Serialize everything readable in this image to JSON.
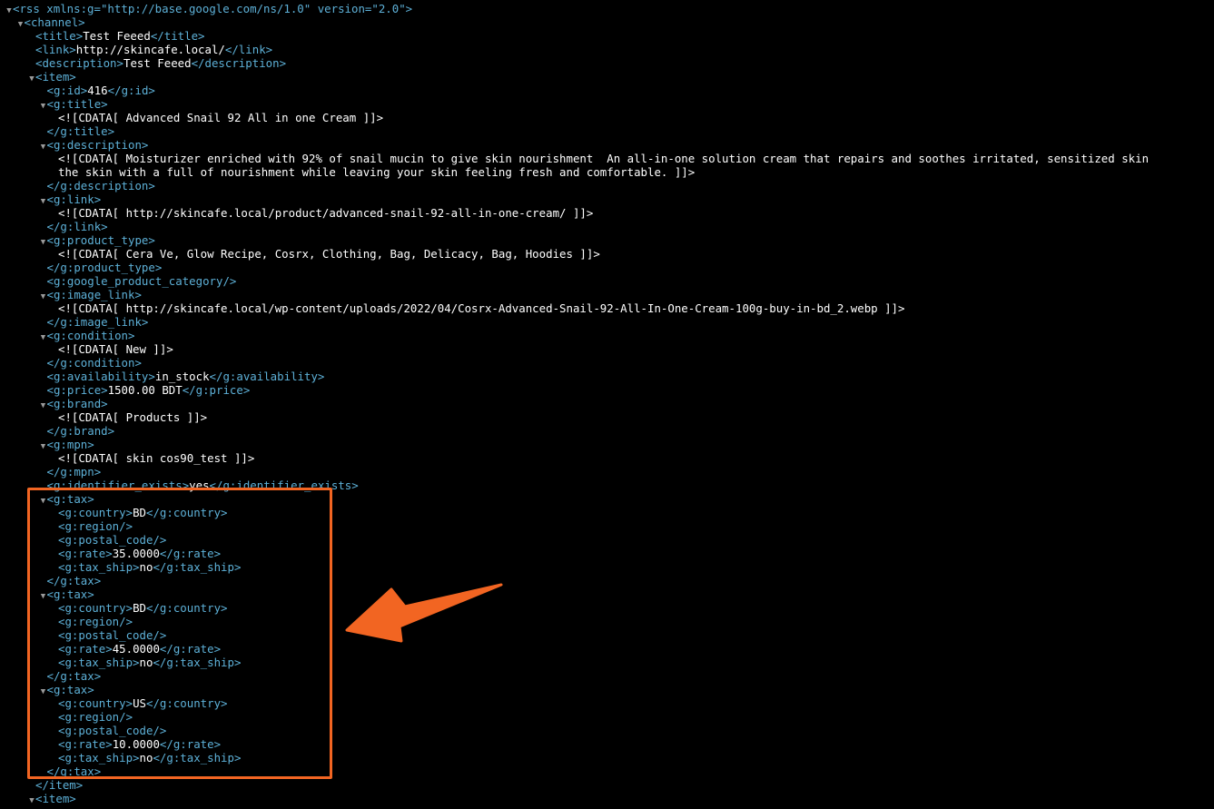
{
  "xml": {
    "rss_open": "<rss xmlns:g=\"http://base.google.com/ns/1.0\" version=\"2.0\">",
    "channel_open": "<channel>",
    "title_line": "<title>Test Feeed</title>",
    "link_line": "<link>http://skincafe.local/</link>",
    "description_line": "<description>Test Feeed</description>",
    "item_open": "<item>",
    "id_line": "<g:id>416</g:id>",
    "g_title_open": "<g:title>",
    "g_title_cdata": "<![CDATA[ Advanced Snail 92 All in one Cream ]]>",
    "g_title_close": "</g:title>",
    "g_description_open": "<g:description>",
    "g_description_cdata_1": "<![CDATA[ Moisturizer enriched with 92% of snail mucin to give skin nourishment  An all-in-one solution cream that repairs and soothes irritated, sensitized skin",
    "g_description_cdata_2": "the skin with a full of nourishment while leaving your skin feeling fresh and comfortable. ]]>",
    "g_description_close": "</g:description>",
    "g_link_open": "<g:link>",
    "g_link_cdata": "<![CDATA[ http://skincafe.local/product/advanced-snail-92-all-in-one-cream/ ]]>",
    "g_link_close": "</g:link>",
    "g_product_type_open": "<g:product_type>",
    "g_product_type_cdata": "<![CDATA[ Cera Ve, Glow Recipe, Cosrx, Clothing, Bag, Delicacy, Bag, Hoodies ]]>",
    "g_product_type_close": "</g:product_type>",
    "g_google_product_category": "<g:google_product_category/>",
    "g_image_link_open": "<g:image_link>",
    "g_image_link_cdata": "<![CDATA[ http://skincafe.local/wp-content/uploads/2022/04/Cosrx-Advanced-Snail-92-All-In-One-Cream-100g-buy-in-bd_2.webp ]]>",
    "g_image_link_close": "</g:image_link>",
    "g_condition_open": "<g:condition>",
    "g_condition_cdata": "<![CDATA[ New ]]>",
    "g_condition_close": "</g:condition>",
    "g_availability_line": "<g:availability>in_stock</g:availability>",
    "g_price_line": "<g:price>1500.00 BDT</g:price>",
    "g_brand_open": "<g:brand>",
    "g_brand_cdata": "<![CDATA[ Products ]]>",
    "g_brand_close": "</g:brand>",
    "g_mpn_open": "<g:mpn>",
    "g_mpn_cdata": "<![CDATA[ skin cos90_test ]]>",
    "g_mpn_close": "</g:mpn>",
    "g_identifier_exists_line": "<g:identifier_exists>yes</g:identifier_exists>",
    "tax_blocks": [
      {
        "open": "<g:tax>",
        "country": "<g:country>BD</g:country>",
        "region": "<g:region/>",
        "postal_code": "<g:postal_code/>",
        "rate": "<g:rate>35.0000</g:rate>",
        "tax_ship": "<g:tax_ship>no</g:tax_ship>",
        "close": "</g:tax>"
      },
      {
        "open": "<g:tax>",
        "country": "<g:country>BD</g:country>",
        "region": "<g:region/>",
        "postal_code": "<g:postal_code/>",
        "rate": "<g:rate>45.0000</g:rate>",
        "tax_ship": "<g:tax_ship>no</g:tax_ship>",
        "close": "</g:tax>"
      },
      {
        "open": "<g:tax>",
        "country": "<g:country>US</g:country>",
        "region": "<g:region/>",
        "postal_code": "<g:postal_code/>",
        "rate": "<g:rate>10.0000</g:rate>",
        "tax_ship": "<g:tax_ship>no</g:tax_ship>",
        "close": "</g:tax>"
      }
    ],
    "item_close": "</item>",
    "item2_open": "<item>"
  },
  "colors": {
    "background": "#000000",
    "tag": "#5db0d7",
    "text": "#ffffff",
    "toggle": "#9a9a9a",
    "annotation": "#f26522"
  },
  "icons": {
    "toggle": "disclosure-triangle-expanded",
    "annotation": "orange-arrow-pointer"
  }
}
